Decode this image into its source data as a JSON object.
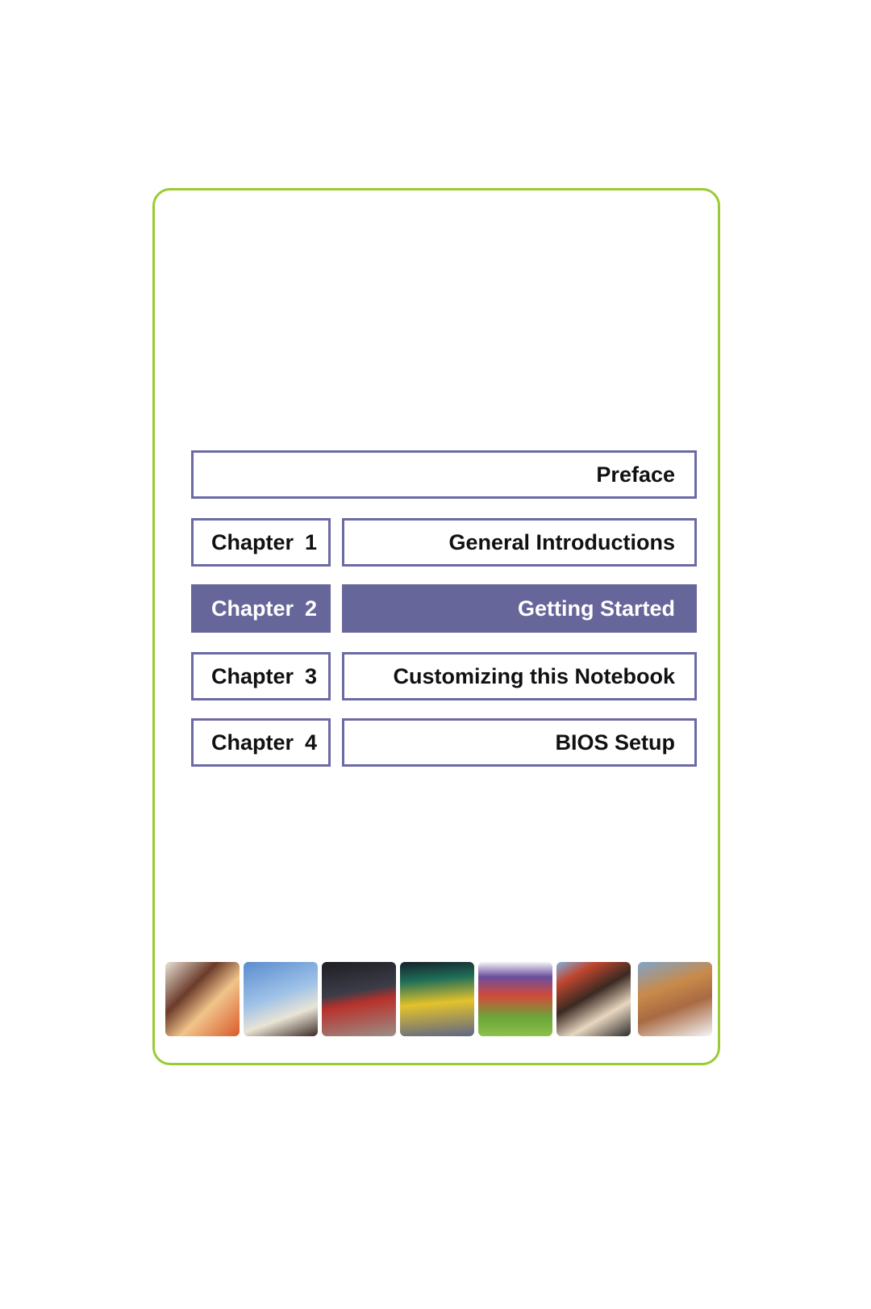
{
  "toc": {
    "preface": "Preface",
    "chapters": [
      {
        "label": "Chapter",
        "number": "1",
        "title": "General Introductions",
        "active": false
      },
      {
        "label": "Chapter",
        "number": "2",
        "title": "Getting Started",
        "active": true
      },
      {
        "label": "Chapter",
        "number": "3",
        "title": "Customizing this Notebook",
        "active": false
      },
      {
        "label": "Chapter",
        "number": "4",
        "title": "BIOS Setup",
        "active": false
      }
    ]
  },
  "colors": {
    "frame": "#99cc33",
    "box_border": "#6b6aa5",
    "active_fill": "#67669a"
  },
  "photos": [
    {
      "name": "two-women-laughing-photo"
    },
    {
      "name": "man-with-phone-leaning-tower-photo"
    },
    {
      "name": "cyclist-photo"
    },
    {
      "name": "yellow-taxi-photo"
    },
    {
      "name": "soccer-players-photo"
    },
    {
      "name": "couple-golden-gate-photo"
    },
    {
      "name": "woman-with-water-bottle-photo"
    }
  ]
}
